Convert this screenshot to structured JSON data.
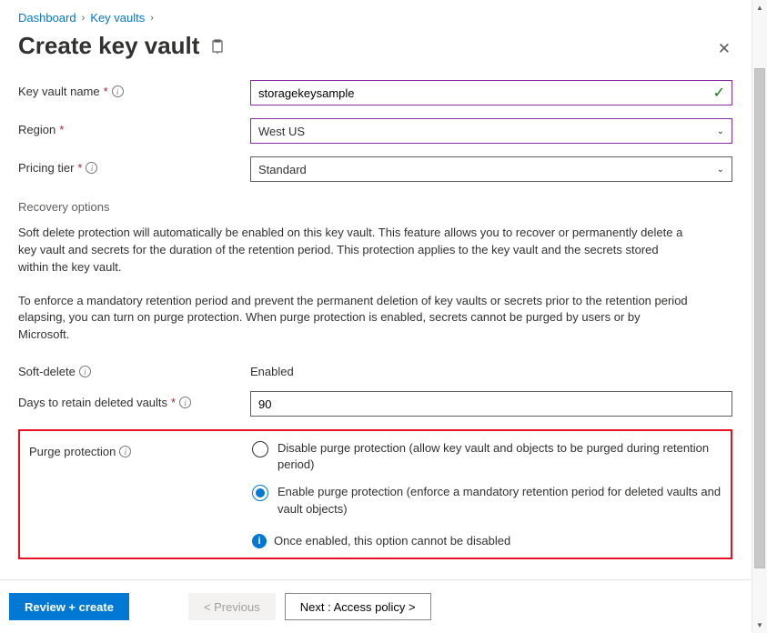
{
  "breadcrumb": {
    "items": [
      "Dashboard",
      "Key vaults"
    ]
  },
  "page": {
    "title": "Create key vault"
  },
  "fields": {
    "name": {
      "label": "Key vault name",
      "value": "storagekeysample"
    },
    "region": {
      "label": "Region",
      "value": "West US"
    },
    "pricing": {
      "label": "Pricing tier",
      "value": "Standard"
    },
    "softdelete": {
      "label": "Soft-delete",
      "value": "Enabled"
    },
    "retention": {
      "label": "Days to retain deleted vaults",
      "value": "90"
    },
    "purge": {
      "label": "Purge protection",
      "options": [
        "Disable purge protection (allow key vault and objects to be purged during retention period)",
        "Enable purge protection (enforce a mandatory retention period for deleted vaults and vault objects)"
      ],
      "selected": 1,
      "notice": "Once enabled, this option cannot be disabled"
    }
  },
  "sections": {
    "recovery": "Recovery options",
    "para1": "Soft delete protection will automatically be enabled on this key vault. This feature allows you to recover or permanently delete a key vault and secrets for the duration of the retention period. This protection applies to the key vault and the secrets stored within the key vault.",
    "para2": "To enforce a mandatory retention period and prevent the permanent deletion of key vaults or secrets prior to the retention period elapsing, you can turn on purge protection. When purge protection is enabled, secrets cannot be purged by users or by Microsoft."
  },
  "footer": {
    "review": "Review + create",
    "previous": "< Previous",
    "next": "Next : Access policy >"
  }
}
